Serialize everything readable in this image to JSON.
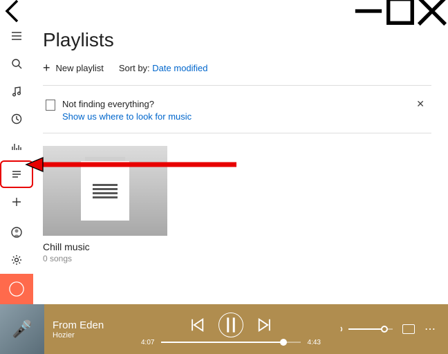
{
  "page": {
    "title": "Playlists"
  },
  "actions": {
    "new_playlist": "New playlist",
    "sort_label": "Sort by:",
    "sort_value": "Date modified"
  },
  "banner": {
    "line1": "Not finding everything?",
    "line2": "Show us where to look for music"
  },
  "playlists": [
    {
      "name": "Chill music",
      "meta": "0 songs"
    }
  ],
  "player": {
    "track": "From Eden",
    "artist": "Hozier",
    "elapsed": "4:07",
    "total": "4:43"
  }
}
